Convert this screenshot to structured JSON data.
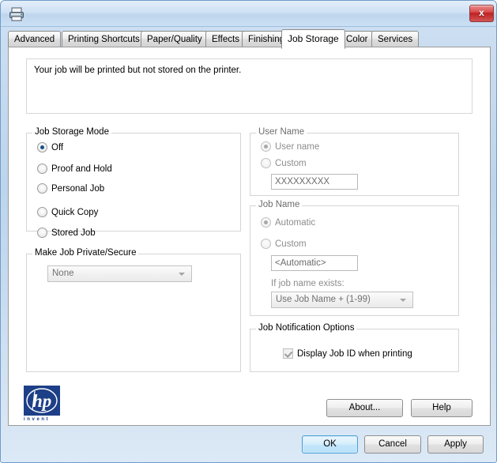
{
  "window": {
    "icon": "printer-icon",
    "title": "",
    "close_label": "x"
  },
  "tabs": [
    {
      "label": "Advanced",
      "active": false
    },
    {
      "label": "Printing Shortcuts",
      "active": false
    },
    {
      "label": "Paper/Quality",
      "active": false
    },
    {
      "label": "Effects",
      "active": false
    },
    {
      "label": "Finishing",
      "active": false
    },
    {
      "label": "Job Storage",
      "active": true
    },
    {
      "label": "Color",
      "active": false
    },
    {
      "label": "Services",
      "active": false
    }
  ],
  "info": {
    "message": "Your job will be printed but not stored on the printer."
  },
  "job_storage_mode": {
    "title": "Job Storage Mode",
    "options": [
      {
        "label": "Off",
        "selected": true
      },
      {
        "label": "Proof and Hold",
        "selected": false
      },
      {
        "label": "Personal Job",
        "selected": false
      },
      {
        "label": "Quick Copy",
        "selected": false
      },
      {
        "label": "Stored Job",
        "selected": false
      }
    ]
  },
  "make_job_private": {
    "title": "Make Job Private/Secure",
    "selected": "None"
  },
  "user_name": {
    "title": "User Name",
    "options": [
      {
        "label": "User name",
        "selected": true
      },
      {
        "label": "Custom",
        "selected": false
      }
    ],
    "custom_value": "XXXXXXXXX"
  },
  "job_name": {
    "title": "Job Name",
    "options": [
      {
        "label": "Automatic",
        "selected": true
      },
      {
        "label": "Custom",
        "selected": false
      }
    ],
    "custom_value": "<Automatic>",
    "if_exists_label": "If job name exists:",
    "if_exists_value": "Use Job Name + (1-99)"
  },
  "job_notification": {
    "title": "Job Notification Options",
    "checkbox_label": "Display Job ID when printing",
    "checked": true
  },
  "branding": {
    "logo": "hp-logo",
    "tagline": "invent"
  },
  "secondary_buttons": {
    "about": "About...",
    "help": "Help"
  },
  "footer_buttons": {
    "ok": "OK",
    "cancel": "Cancel",
    "apply": "Apply"
  },
  "colors": {
    "accent_blue": "#1a4e8a",
    "hp_blue": "#1d3f87",
    "close_red": "#bf2020",
    "title_gradient_top": "#e4eefa",
    "panel_white": "#ffffff"
  }
}
